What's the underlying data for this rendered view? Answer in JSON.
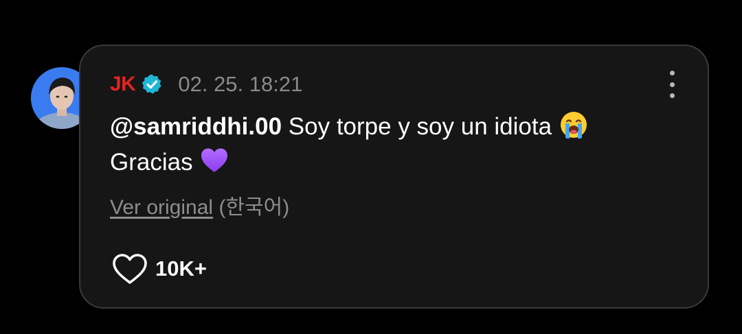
{
  "post": {
    "author": "JK",
    "verified_icon": "verified-badge-icon",
    "timestamp": "02. 25. 18:21",
    "mention": "@samriddhi.00",
    "text_line1": "Soy torpe y soy un idiota",
    "emoji1": "😭",
    "text_line2": "Gracias",
    "emoji2": "💜",
    "view_original_label": "Ver original",
    "original_language": "(한국어)",
    "like_count": "10K+"
  },
  "colors": {
    "background": "#000000",
    "card": "#161616",
    "card_border": "#3a3a3a",
    "author": "#e0251f",
    "verified": "#1fb7d6",
    "timestamp": "#8a8a8a",
    "secondary_text": "#8d8d8d",
    "primary_text": "#ffffff"
  },
  "icons": {
    "menu": "more-vertical-icon",
    "like": "heart-outline-icon",
    "avatar": "profile-photo"
  }
}
